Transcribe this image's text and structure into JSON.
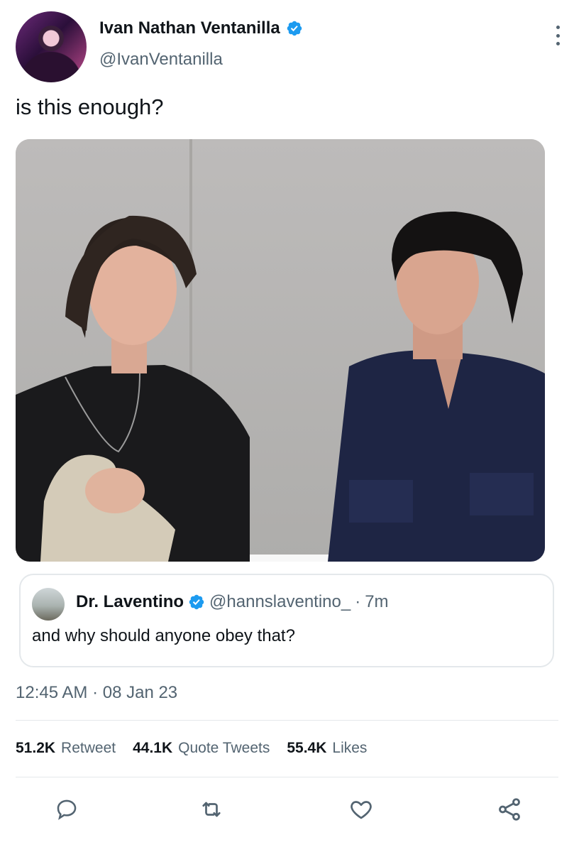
{
  "author": {
    "display_name": "Ivan Nathan Ventanilla",
    "handle": "@IvanVentanilla",
    "verified": true
  },
  "tweet": {
    "text": "is this enough?",
    "timestamp": "12:45 AM · 08 Jan 23"
  },
  "quoted_tweet": {
    "display_name": "Dr. Laventino",
    "handle": "@hannslaventino_",
    "time": "7m",
    "text": "and why should anyone obey that?"
  },
  "stats": {
    "retweets": "51.2K",
    "retweets_label": "Retweet",
    "quotes": "44.1K",
    "quotes_label": "Quote Tweets",
    "likes": "55.4K",
    "likes_label": "Likes"
  },
  "icons": {
    "reply": "reply-icon",
    "retweet": "retweet-icon",
    "like": "like-icon",
    "share": "share-icon",
    "more": "more-icon",
    "verified": "verified-badge-icon"
  },
  "colors": {
    "text": "#0f1419",
    "secondary": "#536471",
    "verified": "#1d9bf0",
    "border": "#e4e8eb"
  }
}
